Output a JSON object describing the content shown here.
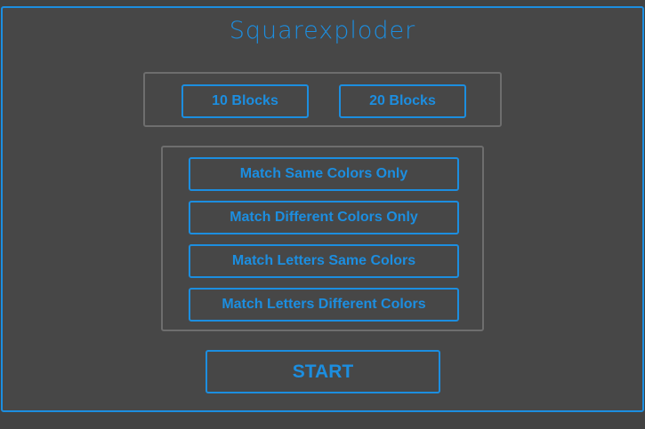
{
  "app": {
    "title": "Squarexploder",
    "accent_color": "#1c8ee0",
    "panel_border_color": "#6e6e6e",
    "background_color": "#474747"
  },
  "block_count": {
    "options": [
      {
        "label": "10 Blocks"
      },
      {
        "label": "20 Blocks"
      }
    ]
  },
  "match_mode": {
    "options": [
      {
        "label": "Match Same Colors Only"
      },
      {
        "label": "Match Different Colors Only"
      },
      {
        "label": "Match Letters Same Colors"
      },
      {
        "label": "Match Letters Different Colors"
      }
    ]
  },
  "start": {
    "label": "START"
  }
}
